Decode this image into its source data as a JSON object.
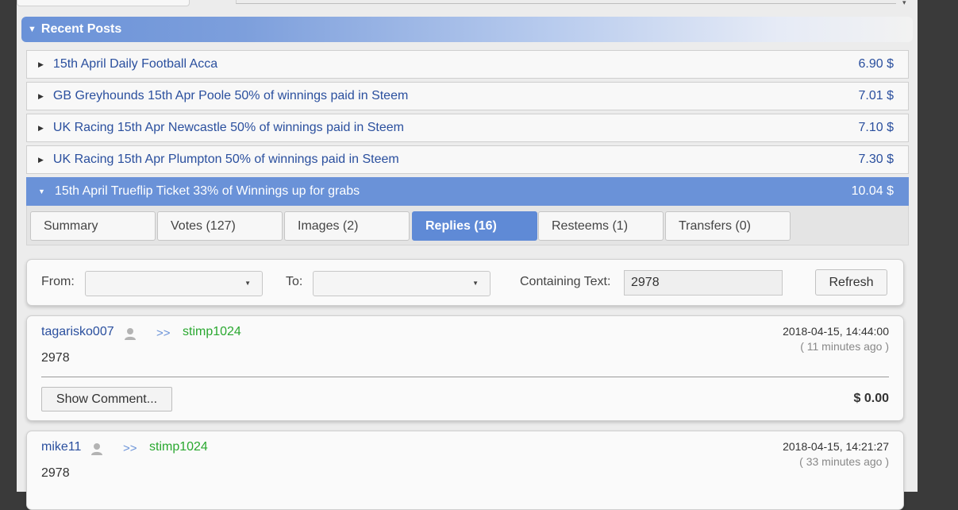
{
  "section": {
    "title": "Recent Posts"
  },
  "posts": [
    {
      "title": "15th April Daily Football Acca",
      "value": "6.90 $"
    },
    {
      "title": "GB Greyhounds 15th Apr Poole 50% of winnings paid in Steem",
      "value": "7.01 $"
    },
    {
      "title": "UK Racing 15th Apr Newcastle 50% of winnings paid in Steem",
      "value": "7.10 $"
    },
    {
      "title": "UK Racing 15th Apr Plumpton 50% of winnings paid in Steem",
      "value": "7.30 $"
    },
    {
      "title": "15th April Trueflip Ticket 33% of Winnings up for grabs",
      "value": "10.04 $"
    }
  ],
  "tabs": [
    {
      "label": "Summary"
    },
    {
      "label": "Votes (127)"
    },
    {
      "label": "Images (2)"
    },
    {
      "label": "Replies (16)"
    },
    {
      "label": "Resteems (1)"
    },
    {
      "label": "Transfers (0)"
    }
  ],
  "filter": {
    "from_label": "From:",
    "to_label": "To:",
    "text_label": "Containing Text:",
    "text_value": "2978",
    "refresh_label": "Refresh"
  },
  "comments": [
    {
      "author": "tagarisko007",
      "arrows": ">>",
      "recipient": "stimp1024",
      "datetime": "2018-04-15, 14:44:00",
      "ago": "( 11 minutes ago )",
      "body": "2978",
      "show_label": "Show Comment...",
      "amount": "$ 0.00"
    },
    {
      "author": "mike11",
      "arrows": ">>",
      "recipient": "stimp1024",
      "datetime": "2018-04-15, 14:21:27",
      "ago": "( 33 minutes ago )",
      "body": "2978"
    }
  ],
  "colors": {
    "accent": "#6a92d8",
    "link": "#2a4f9e",
    "recipient": "#2aa830"
  },
  "icons": {
    "header_toggle": "triangle-down-icon",
    "row_collapsed": "caret-right-icon",
    "row_expanded": "caret-down-icon",
    "user": "person-icon",
    "dropdown": "chevron-down-icon"
  }
}
